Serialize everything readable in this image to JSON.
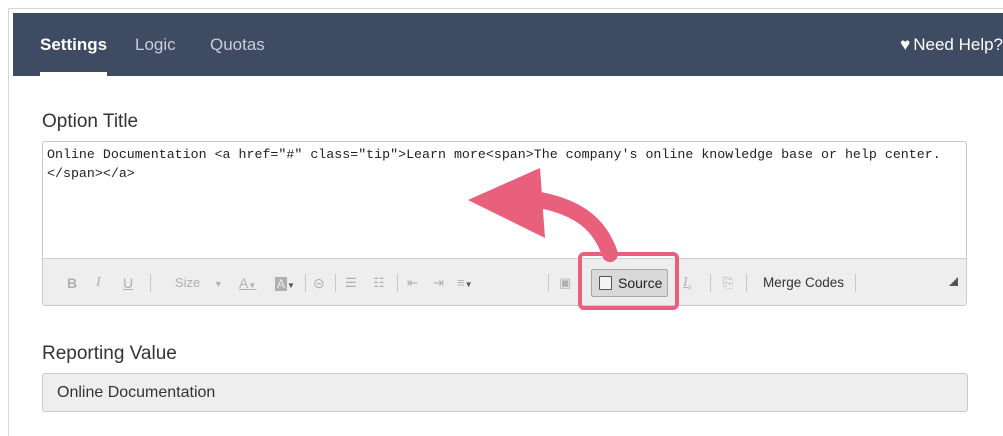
{
  "tabs": [
    {
      "label": "Settings"
    },
    {
      "label": "Logic"
    },
    {
      "label": "Quotas"
    }
  ],
  "help": {
    "label": "Need Help?",
    "icon": "heart-icon"
  },
  "option_title": {
    "label": "Option Title",
    "source_html": "Online Documentation <a href=\"#\" class=\"tip\">Learn more<span>The company's online knowledge base or help center.</span></a>"
  },
  "toolbar": {
    "bold": "B",
    "italic": "I",
    "underline": "U",
    "size": "Size",
    "font_color": "A",
    "bg_color": "A",
    "source": "Source",
    "remove_format": "I",
    "merge_codes": "Merge Codes"
  },
  "reporting_value": {
    "label": "Reporting Value",
    "value": "Online Documentation"
  },
  "colors": {
    "header_bg": "#3f4a63",
    "highlight": "#e8607c"
  }
}
